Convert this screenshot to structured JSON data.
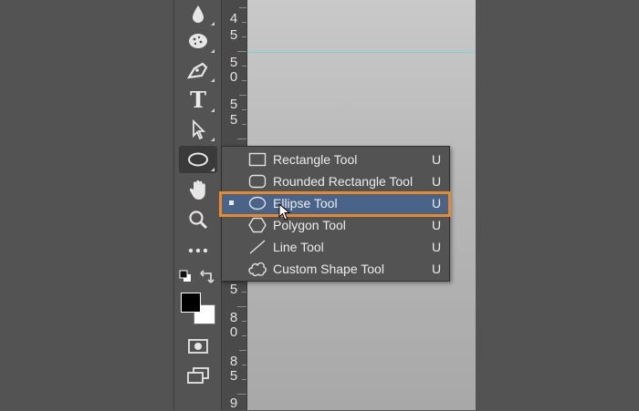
{
  "ruler": {
    "digits": [
      "4",
      "5",
      "5",
      "0",
      "5",
      "5",
      "8",
      "0",
      "8",
      "5",
      "9"
    ]
  },
  "flyout": {
    "items": [
      {
        "label": "Rectangle Tool",
        "shortcut": "U",
        "icon": "rectangle-icon"
      },
      {
        "label": "Rounded Rectangle Tool",
        "shortcut": "U",
        "icon": "rounded-rectangle-icon"
      },
      {
        "label": "Ellipse Tool",
        "shortcut": "U",
        "icon": "ellipse-icon"
      },
      {
        "label": "Polygon Tool",
        "shortcut": "U",
        "icon": "polygon-icon"
      },
      {
        "label": "Line Tool",
        "shortcut": "U",
        "icon": "line-icon"
      },
      {
        "label": "Custom Shape Tool",
        "shortcut": "U",
        "icon": "custom-shape-icon"
      }
    ],
    "selected_index": 2
  },
  "toolbar": {
    "type_tool_glyph": "T",
    "tools": [
      "drop-icon",
      "sponge-icon",
      "pen-icon",
      "type-icon",
      "path-selection-icon",
      "ellipse-icon",
      "hand-icon",
      "zoom-icon",
      "more-icon",
      "quick-mask-icon",
      "screen-mode-icon"
    ]
  },
  "colors": {
    "background": "#535353",
    "selection": "#4a6389",
    "highlight_border": "#e8892a",
    "guide": "#6fd5dc"
  }
}
